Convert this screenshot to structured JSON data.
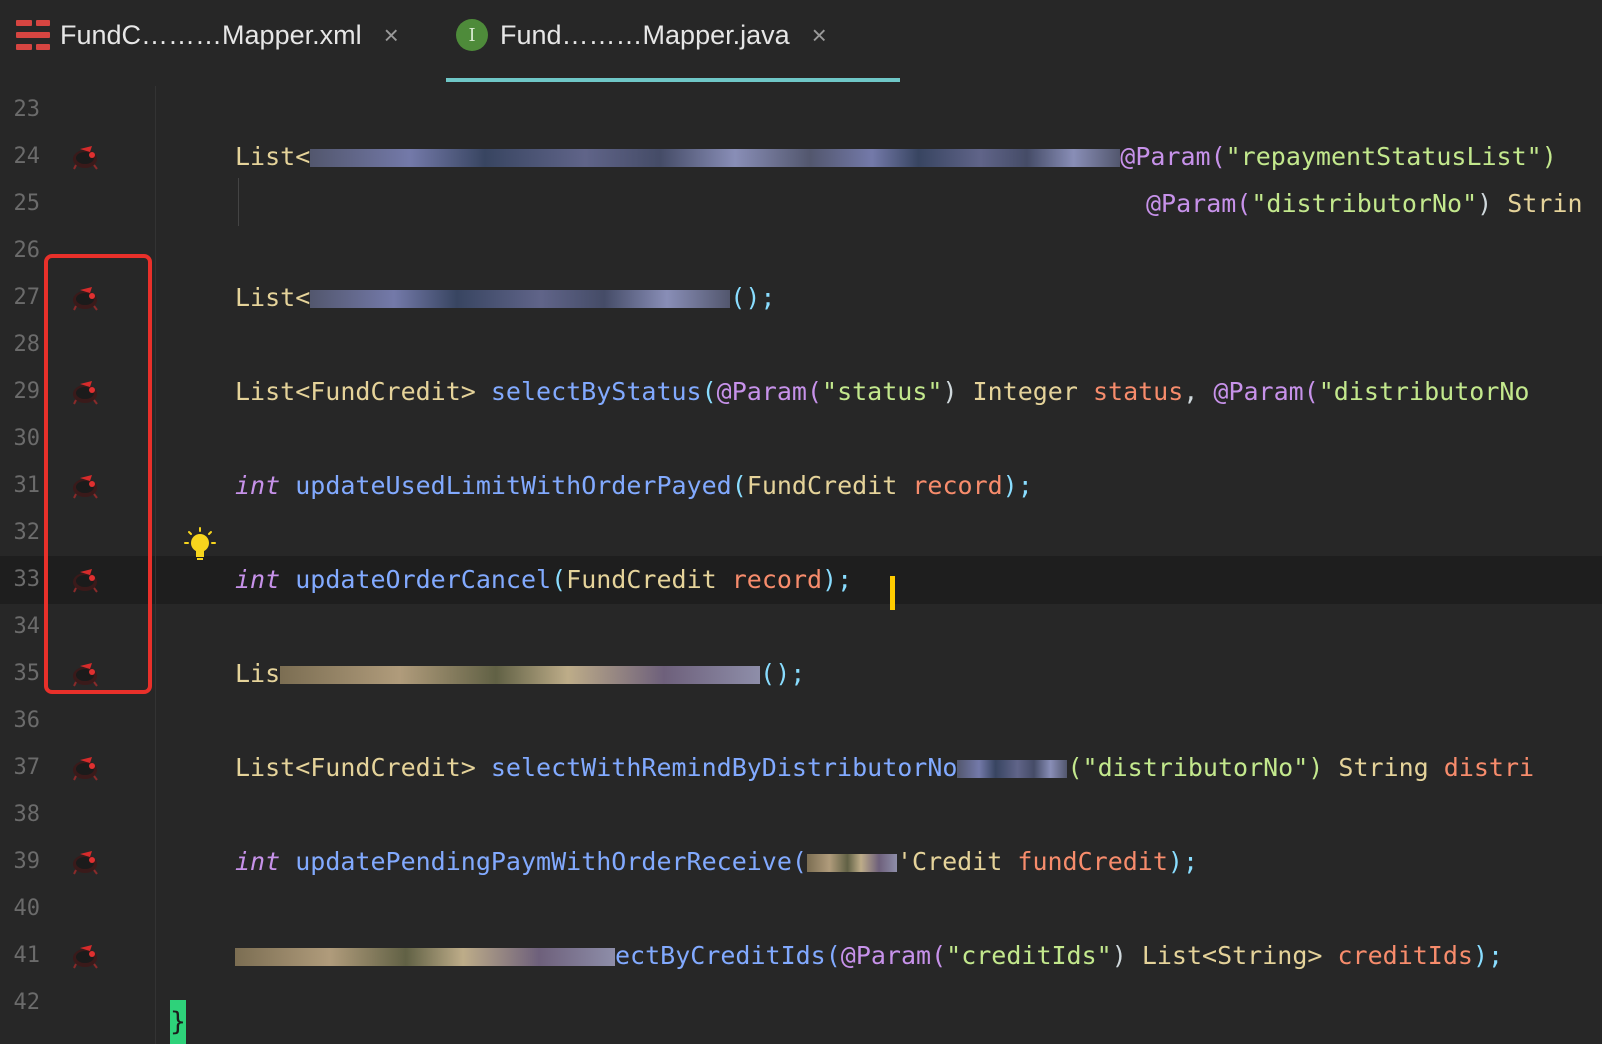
{
  "tabs": [
    {
      "label": "FundC………Mapper.xml",
      "close": "×",
      "icon": "xml-mapper-icon"
    },
    {
      "label": "Fund………Mapper.java",
      "close": "×",
      "icon": "interface-icon",
      "icon_letter": "I",
      "active": true
    }
  ],
  "gutter": {
    "line_numbers": [
      "23",
      "24",
      "25",
      "26",
      "27",
      "28",
      "29",
      "30",
      "31",
      "32",
      "33",
      "34",
      "35",
      "36",
      "37",
      "38",
      "39",
      "40",
      "41",
      "42"
    ],
    "icon": "mybatis-bird-icon",
    "icon_lines": [
      "24",
      "27",
      "29",
      "31",
      "33",
      "35",
      "37",
      "39",
      "41"
    ],
    "highlighted_lines": [
      "27",
      "29",
      "31",
      "33",
      "35"
    ],
    "current_line": "33",
    "bulb_line": "32",
    "bulb_icon": "lightbulb-icon"
  },
  "code": {
    "l24_a": "List<",
    "l24_b": "@Param(",
    "l24_c": "\"repaymentStatusList\")",
    "l25_a": "@Param(",
    "l25_b": "\"distributorNo\"",
    "l25_c": ") ",
    "l25_d": "Strin",
    "l27_a": "List<",
    "l27_b": "();",
    "l29_a": "List<FundCredit> ",
    "l29_b": "selectByStatus",
    "l29_c": "(",
    "l29_d": "@Param(",
    "l29_e": "\"status\"",
    "l29_f": ") ",
    "l29_g": "Integer ",
    "l29_h": "status",
    "l29_i": ", ",
    "l29_j": "@Param(",
    "l29_k": "\"distributorNo",
    "l31_a": "int ",
    "l31_b": "updateUsedLimitWithOrderPayed",
    "l31_c": "(",
    "l31_d": "FundCredit ",
    "l31_e": "record",
    "l31_f": ");",
    "l33_a": "int ",
    "l33_b": "updateOrderCancel",
    "l33_c": "(",
    "l33_d": "FundCredit ",
    "l33_e": "record",
    "l33_f": ");",
    "l35_a": "Lis",
    "l35_b": "();",
    "l37_a": "List<FundCredit> ",
    "l37_b": "selectWithRemindByDistributorNo",
    "l37_c": "(\"distributorNo\")",
    "l37_d": " String ",
    "l37_e": "distri",
    "l39_a": "int ",
    "l39_b": "updatePendingPaym",
    "l39_c": "WithOrderReceive(",
    "l39_d": "'Credit ",
    "l39_e": "fundCredit",
    "l39_f": ");",
    "l41_a": "ectByCreditIds(",
    "l41_b": "@Param(",
    "l41_c": "\"creditIds\"",
    "l41_d": ") ",
    "l41_e": "List<String> ",
    "l41_f": "creditIds",
    "l41_g": ");",
    "l42": "}"
  },
  "colors": {
    "background": "#272727",
    "active_tab_underline": "#6fc7c7",
    "highlight_box": "#e8302a",
    "caret": "#ffcc00",
    "brace_match": "#2ed27a"
  }
}
